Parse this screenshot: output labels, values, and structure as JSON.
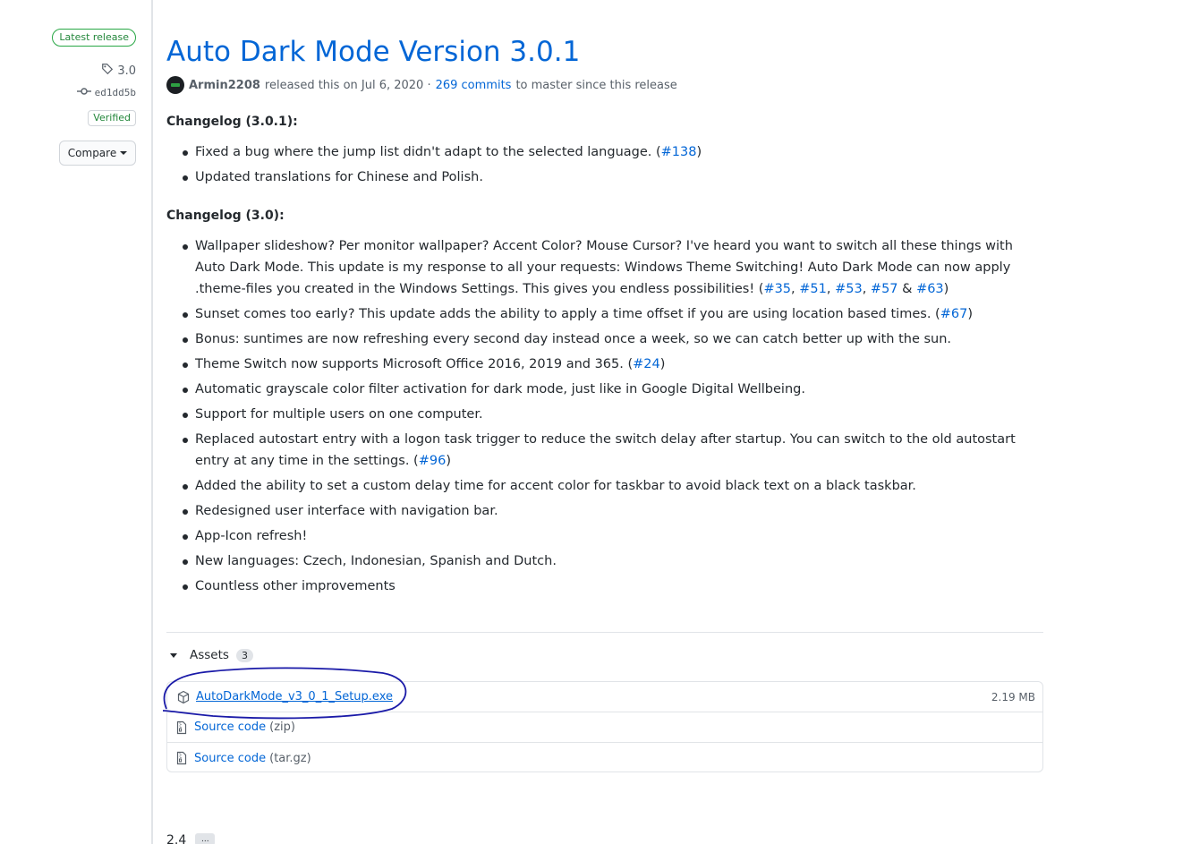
{
  "sidebar": {
    "latest_badge": "Latest release",
    "tag": "3.0",
    "commit": "ed1dd5b",
    "verified": "Verified",
    "compare_label": "Compare"
  },
  "release": {
    "title": "Auto Dark Mode Version 3.0.1",
    "author": "Armin2208",
    "released_text": "released this on Jul 6, 2020 ·",
    "commits_link": "269 commits",
    "commits_suffix": "to master since this release"
  },
  "changelog_301": {
    "heading": "Changelog (3.0.1):",
    "items": [
      {
        "text": "Fixed a bug where the jump list didn't adapt to the selected language. (",
        "link": "#138",
        "suffix": ")"
      },
      {
        "text": "Updated translations for Chinese and Polish.",
        "link": "",
        "suffix": ""
      }
    ]
  },
  "changelog_30": {
    "heading": "Changelog (3.0):",
    "item0_text": "Wallpaper slideshow? Per monitor wallpaper? Accent Color? Mouse Cursor? I've heard you want to switch all these things with Auto Dark Mode. This update is my response to all your requests: Windows Theme Switching! Auto Dark Mode can now apply .theme-files you created in the Windows Settings. This gives you endless possibilities! (",
    "item0_links": [
      "#35",
      "#51",
      "#53",
      "#57",
      "#63"
    ],
    "item0_sep": [
      ", ",
      ", ",
      ", ",
      " & "
    ],
    "item0_suffix": ")",
    "item1_text": "Sunset comes too early? This update adds the ability to apply a time offset if you are using location based times. (",
    "item1_link": "#67",
    "item1_suffix": ")",
    "item2_text": "Bonus: suntimes are now refreshing every second day instead once a week, so we can catch better up with the sun.",
    "item3_text": "Theme Switch now supports Microsoft Office 2016, 2019 and 365. (",
    "item3_link": "#24",
    "item3_suffix": ")",
    "item4_text": "Automatic grayscale color filter activation for dark mode, just like in Google Digital Wellbeing.",
    "item5_text": "Support for multiple users on one computer.",
    "item6_text": "Replaced autostart entry with a logon task trigger to reduce the switch delay after startup. You can switch to the old autostart entry at any time in the settings. (",
    "item6_link": "#96",
    "item6_suffix": ")",
    "item7_text": "Added the ability to set a custom delay time for accent color for taskbar to avoid black text on a black taskbar.",
    "item8_text": "Redesigned user interface with navigation bar.",
    "item9_text": "App-Icon refresh!",
    "item10_text": "New languages: Czech, Indonesian, Spanish and Dutch.",
    "item11_text": "Countless other improvements"
  },
  "assets": {
    "label": "Assets",
    "count": "3",
    "files": [
      {
        "name": "AutoDarkMode_v3_0_1_Setup.exe",
        "size": "2.19 MB",
        "icon": "package-icon"
      },
      {
        "name": "Source code",
        "suffix": "(zip)",
        "icon": "file-zip-icon"
      },
      {
        "name": "Source code",
        "suffix": "(tar.gz)",
        "icon": "file-zip-icon"
      }
    ]
  },
  "next_release": {
    "title": "2.4",
    "more": "..."
  },
  "colors": {
    "link": "#0366d6",
    "verified": "#22863a",
    "annotation": "#1a1aa8"
  }
}
